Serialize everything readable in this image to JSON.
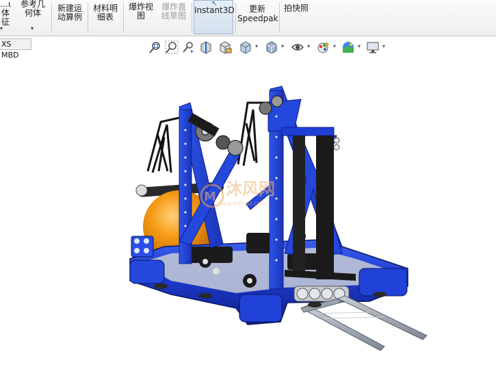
{
  "ribbon": {
    "buttons": [
      {
        "id": "btn-0",
        "label": "…ι体\n征",
        "state": "normal"
      },
      {
        "id": "btn-1",
        "label": "参考几\n何体",
        "state": "normal"
      },
      {
        "id": "btn-2",
        "label": "新建运\n动算例",
        "state": "normal"
      },
      {
        "id": "btn-3",
        "label": "材料明\n细表",
        "state": "normal"
      },
      {
        "id": "btn-4",
        "label": "爆炸视\n图",
        "state": "normal"
      },
      {
        "id": "btn-5",
        "label": "爆炸直\n线草图",
        "state": "disabled"
      },
      {
        "id": "btn-6",
        "label": "Instant3D",
        "state": "active"
      },
      {
        "id": "btn-7",
        "label": "更新\nSpeedpak",
        "state": "normal"
      },
      {
        "id": "btn-8",
        "label": "拍快照",
        "state": "normal"
      }
    ]
  },
  "tabs": {
    "mbd": "XS MBD"
  },
  "hud_icons": [
    "zoom-to-fit-icon",
    "zoom-to-area-icon",
    "previous-view-icon",
    "section-view-icon",
    "dynamic-annotation-icon",
    "view-orientation-icon",
    "display-style-icon",
    "hide-show-items-icon",
    "edit-appearance-icon",
    "apply-scene-icon",
    "view-settings-icon"
  ],
  "watermark": {
    "text": "沐风网",
    "url": "www.mfcad.com"
  },
  "colors": {
    "robot_blue": "#1e3fd6",
    "robot_dark_blue": "#0d1f8f",
    "ball_orange": "#f59a14",
    "metal_grey": "#9aa3ad",
    "black": "#1a1a1a"
  }
}
